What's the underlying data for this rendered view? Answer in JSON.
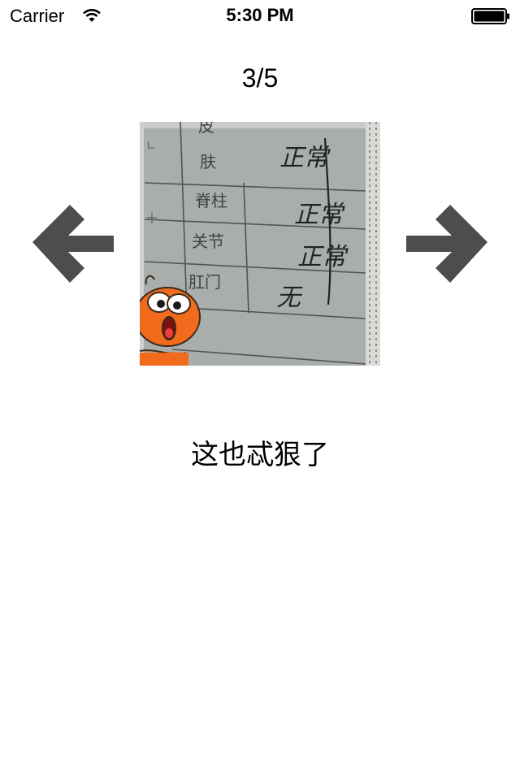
{
  "status_bar": {
    "carrier": "Carrier",
    "time": "5:30 PM"
  },
  "viewer": {
    "page_indicator": "3/5",
    "prev_icon": "arrow-left-icon",
    "next_icon": "arrow-right-icon",
    "caption": "这也忒狠了",
    "photo": {
      "form_rows": [
        "肤",
        "脊柱",
        "关节",
        "肛门"
      ],
      "top_partial": "皮",
      "handwritten_values": [
        "正常",
        "正常",
        "正常",
        "无"
      ]
    }
  },
  "colors": {
    "arrow": "#4d4d4f",
    "background": "#ffffff",
    "paper": "#a7acaa",
    "cartoon": "#f26a1b"
  }
}
